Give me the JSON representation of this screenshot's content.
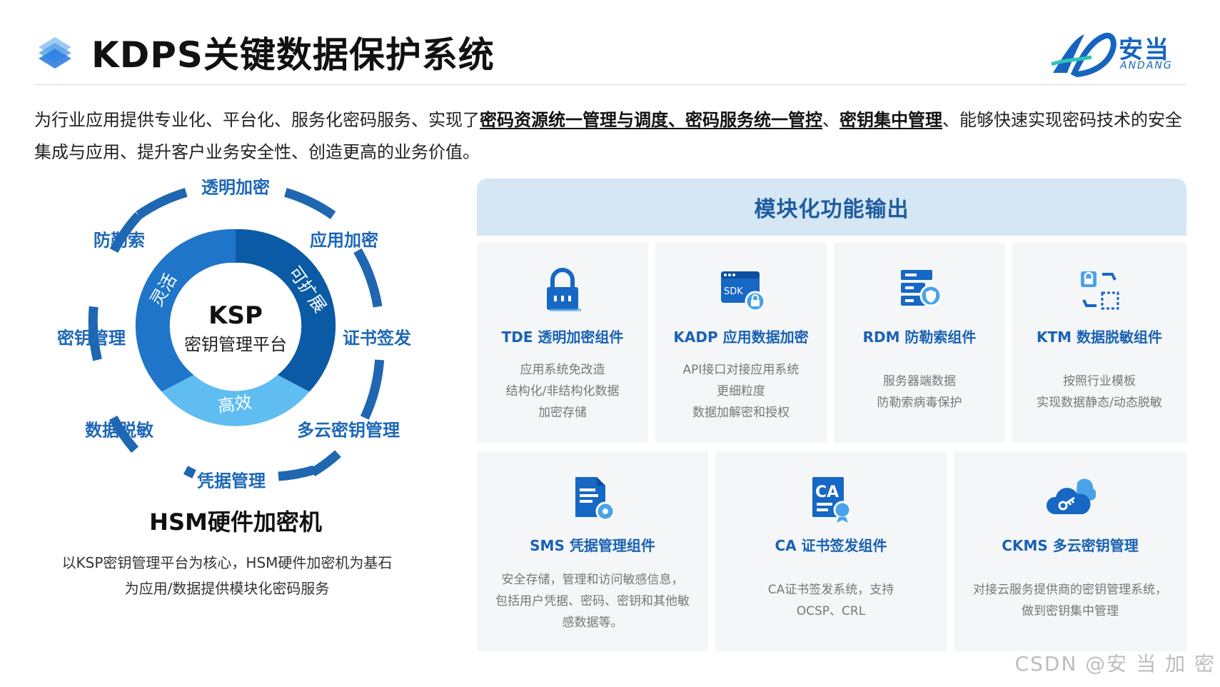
{
  "header": {
    "title": "KDPS关键数据保护系统"
  },
  "logo": {
    "brand": "安当",
    "sub": "ANDANG"
  },
  "intro": {
    "part1": "为行业应用提供专业化、平台化、服务化密码服务、实现了",
    "hl1": "密码资源统一管理与调度、",
    "hl2": "密码服务统一管控",
    "sep": "、",
    "hl3": "密钥集中管理",
    "part2": "、能够快速实现密码技术的安全集成与应用、提升客户业务安全性、创造更高的业务价值。"
  },
  "diagram": {
    "center_title": "KSP",
    "center_sub": "密钥管理平台",
    "segments": {
      "left": "灵活",
      "right": "可扩展",
      "bottom": "高效"
    },
    "ring_labels": {
      "top": "透明加密",
      "top_right": "应用加密",
      "right": "证书签发",
      "bottom_right": "多云密钥管理",
      "bottom": "凭据管理",
      "bottom_left": "数据脱敏",
      "left": "密钥管理",
      "top_left": "防勒索"
    }
  },
  "hsm": {
    "title": "HSM硬件加密机",
    "desc_line1": "以KSP密钥管理平台为核心，HSM硬件加密机为基石",
    "desc_line2": "为应用/数据提供模块化密码服务"
  },
  "modules": {
    "header": "模块化功能输出",
    "cards": [
      {
        "title": "TDE 透明加密组件",
        "lines": [
          "应用系统免改造",
          "结构化/非结构化数据",
          "加密存储"
        ],
        "icon": "lock-icon"
      },
      {
        "title": "KADP 应用数据加密",
        "lines": [
          "API接口对接应用系统",
          "更细粒度",
          "数据加解密和授权"
        ],
        "icon": "sdk-icon"
      },
      {
        "title": "RDM 防勒索组件",
        "lines": [
          "服务器端数据",
          "防勒索病毒保护"
        ],
        "icon": "server-shield-icon"
      },
      {
        "title": "KTM 数据脱敏组件",
        "lines": [
          "按照行业模板",
          "实现数据静态/动态脱敏"
        ],
        "icon": "masking-icon"
      },
      {
        "title": "SMS 凭据管理组件",
        "lines": [
          "安全存储，管理和访问敏感信息，",
          "包括用户凭据、密码、密钥和其他敏",
          "感数据等。"
        ],
        "icon": "document-gear-icon"
      },
      {
        "title": "CA 证书签发组件",
        "lines": [
          "CA证书签发系统，支持",
          "OCSP、CRL"
        ],
        "icon": "certificate-icon"
      },
      {
        "title": "CKMS 多云密钥管理",
        "lines": [
          "对接云服务提供商的密钥管理系统，",
          "做到密钥集中管理"
        ],
        "icon": "cloud-key-icon"
      }
    ]
  },
  "watermark": "CSDN @安 当 加 密",
  "colors": {
    "dark_blue": "#0b5aa6",
    "mid_blue": "#1f75c8",
    "light_blue": "#5fbdf2",
    "label_blue": "#1e68b6",
    "header_bg": "#d5e6f5",
    "card_bg": "#f4f6f8"
  }
}
